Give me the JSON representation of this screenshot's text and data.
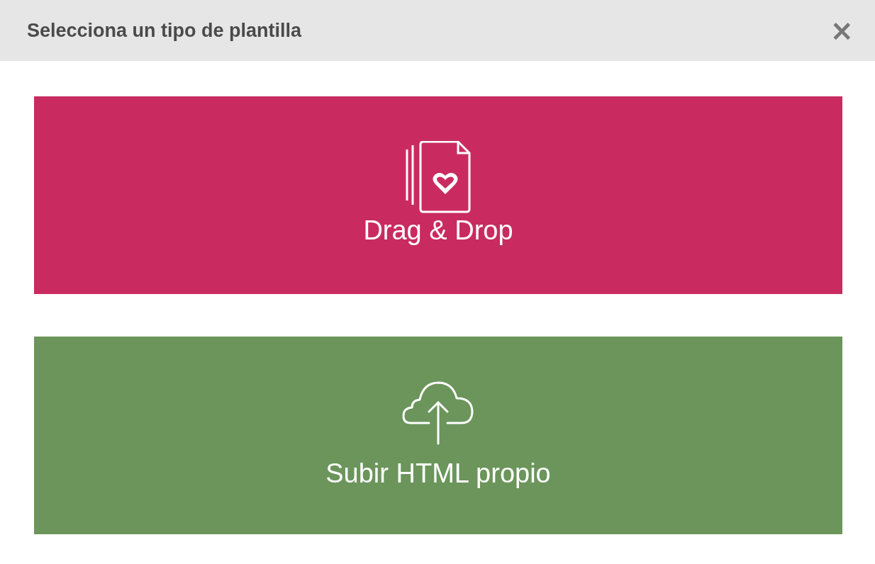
{
  "dialog": {
    "title": "Selecciona un tipo de plantilla",
    "close": "×"
  },
  "options": [
    {
      "kind": "drag_drop",
      "label": "Drag & Drop",
      "color": "#c92b61"
    },
    {
      "kind": "upload",
      "label": "Subir HTML propio",
      "color": "#6b955b"
    }
  ]
}
